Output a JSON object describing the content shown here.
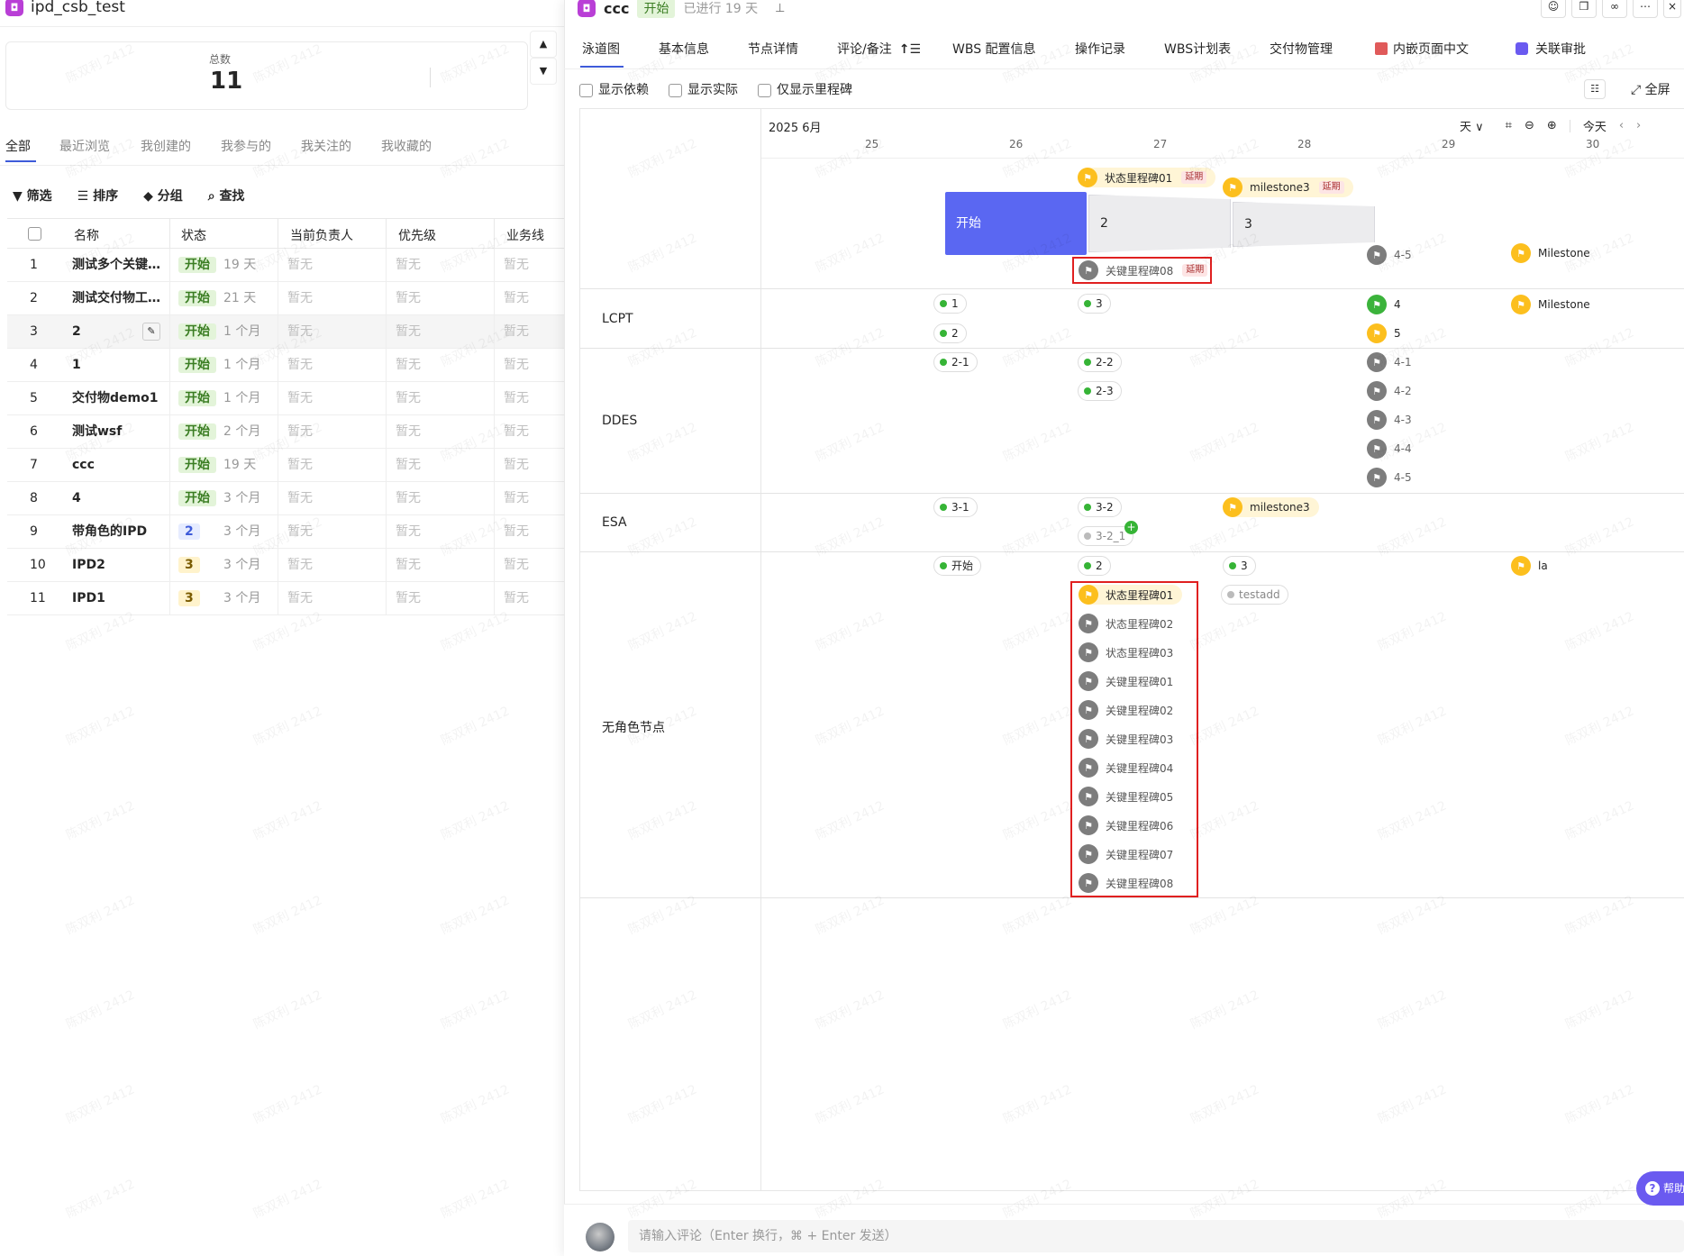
{
  "left": {
    "title": "ipd_csb_test",
    "total_label": "总数",
    "total_value": "11",
    "tabs": [
      "全部",
      "最近浏览",
      "我创建的",
      "我参与的",
      "我关注的",
      "我收藏的"
    ],
    "tools": {
      "filter": "筛选",
      "sort": "排序",
      "group": "分组",
      "find": "查找"
    },
    "columns": [
      "名称",
      "状态",
      "当前负责人",
      "优先级",
      "业务线"
    ],
    "rows": [
      {
        "no": "1",
        "name": "测试多个关键…",
        "status": "开始",
        "status_type": "green",
        "duration": "19 天",
        "owner": "暂无",
        "priority": "暂无",
        "line": "暂无"
      },
      {
        "no": "2",
        "name": "测试交付物工…",
        "status": "开始",
        "status_type": "green",
        "duration": "21 天",
        "owner": "暂无",
        "priority": "暂无",
        "line": "暂无"
      },
      {
        "no": "3",
        "name": "2",
        "status": "开始",
        "status_type": "green",
        "duration": "1 个月",
        "owner": "暂无",
        "priority": "暂无",
        "line": "暂无"
      },
      {
        "no": "4",
        "name": "1",
        "status": "开始",
        "status_type": "green",
        "duration": "1 个月",
        "owner": "暂无",
        "priority": "暂无",
        "line": "暂无"
      },
      {
        "no": "5",
        "name": "交付物demo1",
        "status": "开始",
        "status_type": "green",
        "duration": "1 个月",
        "owner": "暂无",
        "priority": "暂无",
        "line": "暂无"
      },
      {
        "no": "6",
        "name": "测试wsf",
        "status": "开始",
        "status_type": "green",
        "duration": "2 个月",
        "owner": "暂无",
        "priority": "暂无",
        "line": "暂无"
      },
      {
        "no": "7",
        "name": "ccc",
        "status": "开始",
        "status_type": "green",
        "duration": "19 天",
        "owner": "暂无",
        "priority": "暂无",
        "line": "暂无"
      },
      {
        "no": "8",
        "name": "4",
        "status": "开始",
        "status_type": "green",
        "duration": "3 个月",
        "owner": "暂无",
        "priority": "暂无",
        "line": "暂无"
      },
      {
        "no": "9",
        "name": "带角色的IPD",
        "status": "2",
        "status_type": "blue",
        "duration": "3 个月",
        "owner": "暂无",
        "priority": "暂无",
        "line": "暂无"
      },
      {
        "no": "10",
        "name": "IPD2",
        "status": "3",
        "status_type": "yellow",
        "duration": "3 个月",
        "owner": "暂无",
        "priority": "暂无",
        "line": "暂无"
      },
      {
        "no": "11",
        "name": "IPD1",
        "status": "3",
        "status_type": "yellow",
        "duration": "3 个月",
        "owner": "暂无",
        "priority": "暂无",
        "line": "暂无"
      }
    ]
  },
  "right": {
    "title": "ccc",
    "status": "开始",
    "elapsed": "已进行 19 天",
    "tabs": [
      "泳道图",
      "基本信息",
      "节点详情",
      "评论/备注",
      "WBS 配置信息",
      "操作记录",
      "WBS计划表",
      "交付物管理",
      "内嵌页面中文",
      "关联审批"
    ],
    "options": [
      "显示依赖",
      "显示实际",
      "仅显示里程碑"
    ],
    "fullscreen": "全屏",
    "month": "2025 6月",
    "days": [
      "25",
      "26",
      "27",
      "28",
      "29",
      "30"
    ],
    "scale": "天",
    "today": "今天",
    "lanes": [
      "LCPT",
      "DDES",
      "ESA",
      "无角色节点"
    ],
    "phase_bars": [
      "开始",
      "2",
      "3"
    ],
    "late_label": "延期",
    "top_milestones": {
      "m1": "状态里程碑01",
      "m2": "milestone3",
      "m3": "关键里程碑08",
      "m4": "4-5",
      "m5": "Milestone"
    },
    "lcpt": {
      "n1": "1",
      "n2": "2",
      "n3": "3",
      "n4": "4",
      "n5": "5",
      "m": "Milestone"
    },
    "ddes": {
      "a": "2-1",
      "b": "2-2",
      "c": "2-3",
      "d": [
        "4-1",
        "4-2",
        "4-3",
        "4-4",
        "4-5"
      ]
    },
    "esa": {
      "a": "3-1",
      "b": "3-2",
      "c": "3-2_1",
      "m": "milestone3"
    },
    "none": {
      "a": "开始",
      "b": "2",
      "c": "3",
      "d": "testadd",
      "e": "la",
      "list": [
        "状态里程碑01",
        "状态里程碑02",
        "状态里程碑03",
        "关键里程碑01",
        "关键里程碑02",
        "关键里程碑03",
        "关键里程碑04",
        "关键里程碑05",
        "关键里程碑06",
        "关键里程碑07",
        "关键里程碑08"
      ]
    },
    "comment_placeholder": "请输入评论（Enter 换行，⌘ + Enter 发送）",
    "help": "帮助"
  },
  "watermark": "陈双利 2412",
  "colors": {
    "phase_blue": "#5a67f2",
    "milestone_yellow": "#fcbf1e",
    "done_green": "#36b436",
    "highlight_red": "#e02020"
  }
}
